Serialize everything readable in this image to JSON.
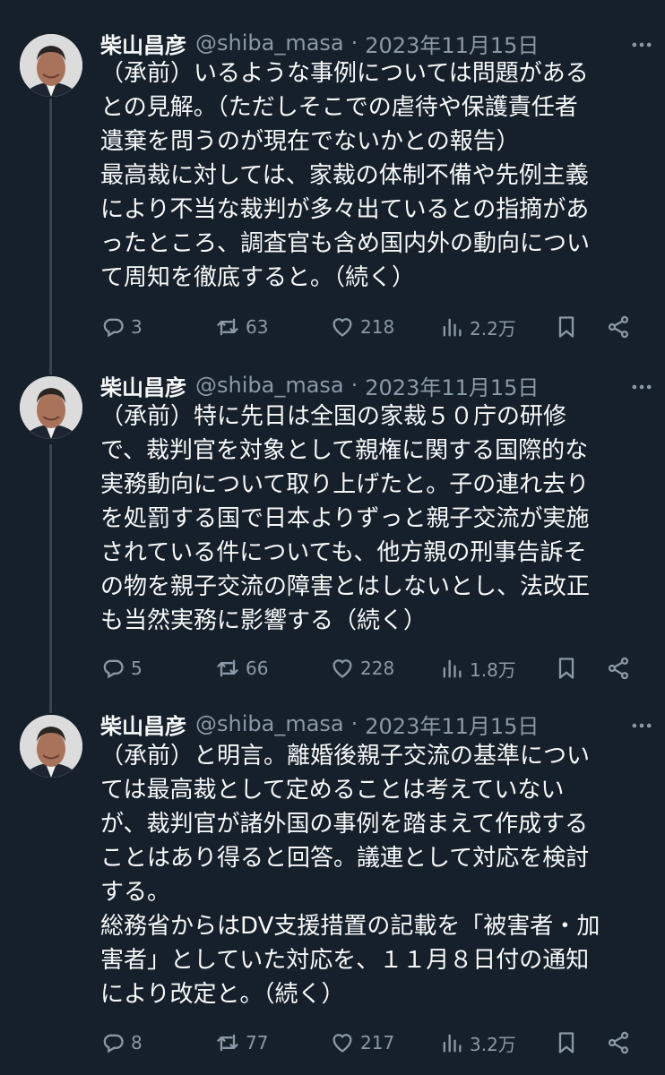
{
  "tweets": [
    {
      "name": "柴山昌彦",
      "handle": "@shiba_masa",
      "separator": "·",
      "date": "2023年11月15日",
      "lines": [
        "（承前）いるような事例については問題がある",
        "との見解。（ただしそこでの虐待や保護責任者",
        "遺棄を問うのが現在でないかとの報告）",
        "最高裁に対しては、家裁の体制不備や先例主義",
        "により不当な裁判が多々出ているとの指摘があ",
        "ったところ、調査官も含め国内外の動向につい",
        "て周知を徹底すると。（続く）"
      ],
      "replies": "3",
      "retweets": "63",
      "likes": "218",
      "views": "2.2万"
    },
    {
      "name": "柴山昌彦",
      "handle": "@shiba_masa",
      "separator": "·",
      "date": "2023年11月15日",
      "lines": [
        "（承前）特に先日は全国の家裁５０庁の研修",
        "で、裁判官を対象として親権に関する国際的な",
        "実務動向について取り上げたと。子の連れ去り",
        "を処罰する国で日本よりずっと親子交流が実施",
        "されている件についても、他方親の刑事告訴そ",
        "の物を親子交流の障害とはしないとし、法改正",
        "も当然実務に影響する（続く）"
      ],
      "replies": "5",
      "retweets": "66",
      "likes": "228",
      "views": "1.8万"
    },
    {
      "name": "柴山昌彦",
      "handle": "@shiba_masa",
      "separator": "·",
      "date": "2023年11月15日",
      "lines": [
        "（承前）と明言。離婚後親子交流の基準につい",
        "ては最高裁として定めることは考えていない",
        "が、裁判官が諸外国の事例を踏まえて作成する",
        "ことはあり得ると回答。議連として対応を検討",
        "する。",
        "総務省からはDV支援措置の記載を「被害者・加",
        "害者」としていた対応を、１１月８日付の通知",
        "により改定と。（続く）"
      ],
      "replies": "8",
      "retweets": "77",
      "likes": "217",
      "views": "3.2万"
    }
  ],
  "icons": {
    "reply": "reply-icon",
    "retweet": "retweet-icon",
    "like": "heart-icon",
    "views": "views-icon",
    "bookmark": "bookmark-icon",
    "share": "share-icon",
    "more": "more-icon"
  },
  "colors": {
    "background": "#15202b",
    "text": "#f7f9f9",
    "secondary": "#8b98a5",
    "thread_line": "#38444d"
  }
}
